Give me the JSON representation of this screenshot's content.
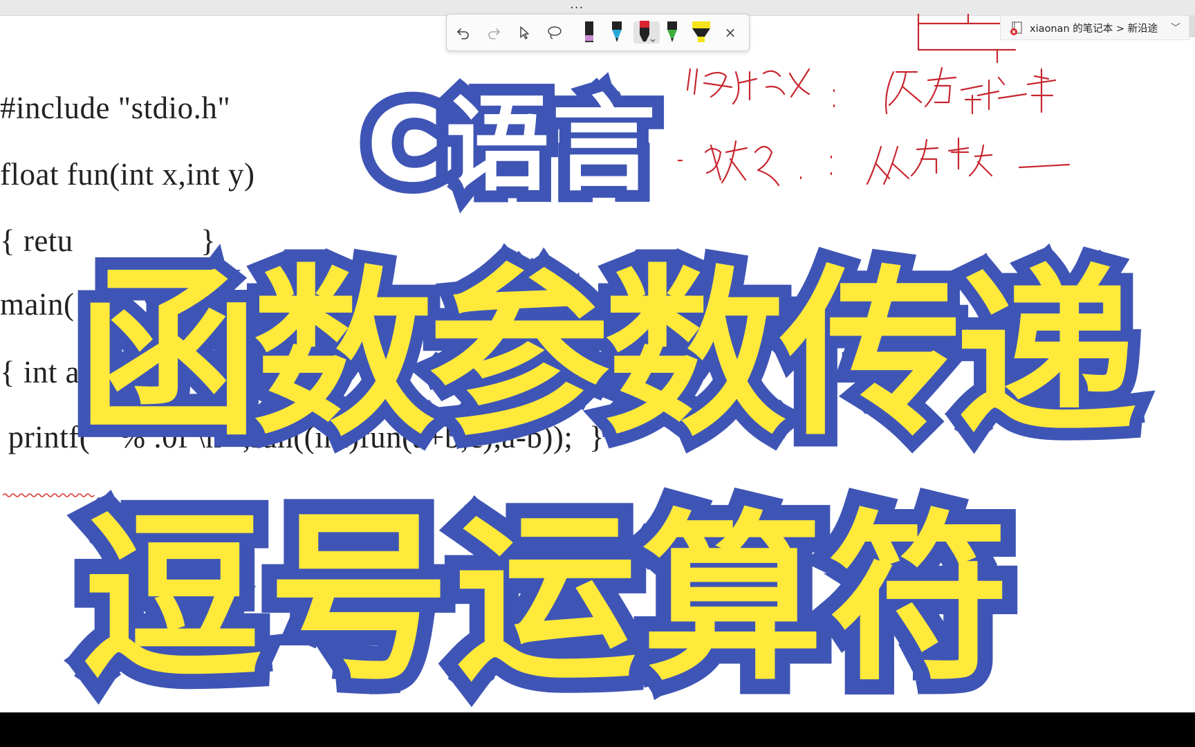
{
  "topbar": {
    "dots": "..."
  },
  "toolbar": {
    "tools": [
      "undo-icon",
      "redo-icon",
      "select-icon",
      "lasso-icon",
      "pen-black-icon",
      "pen-blue-icon",
      "pen-red-icon",
      "pen-green-icon",
      "highlighter-yellow-icon"
    ],
    "selected": "pen-red-icon",
    "close_label": "×",
    "colors": {
      "black": "#222222",
      "blue": "#2aa7d8",
      "red": "#d9232e",
      "green": "#3fae3f",
      "yellow": "#f5e31c"
    }
  },
  "notebook_selector": {
    "label": "xiaonan 的笔记本 > 新沿途",
    "chevron": "﹀"
  },
  "code": {
    "line1": "#include \"stdio.h\"",
    "line2": "float fun(int x,int y)",
    "line3": "{ retu",
    "line3_end": "}",
    "line4": "main(",
    "line5": "{ int a=2,b=3,c=6;",
    "line6": " printf( \" % .0f \\n \",fun((int)fun(a+b,c),a-b));  }"
  },
  "overlay": {
    "badge": "C语言",
    "main_title": "函数参数传递",
    "sub_title": "逗号运算符",
    "fill_color": "#ffe93a",
    "outline_color": "#3f55b5"
  },
  "ink_color": "#c7262f"
}
